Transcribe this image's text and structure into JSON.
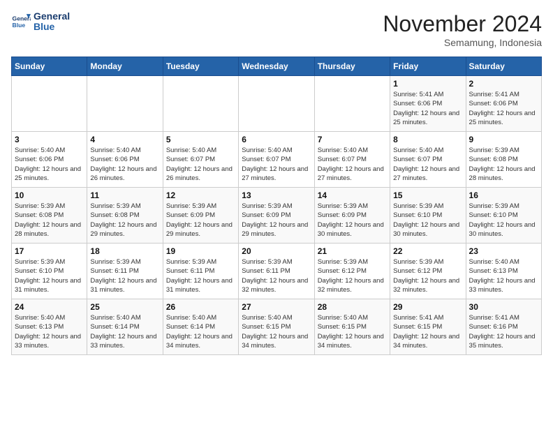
{
  "logo": {
    "text_general": "General",
    "text_blue": "Blue"
  },
  "header": {
    "month": "November 2024",
    "location": "Semamung, Indonesia"
  },
  "weekdays": [
    "Sunday",
    "Monday",
    "Tuesday",
    "Wednesday",
    "Thursday",
    "Friday",
    "Saturday"
  ],
  "weeks": [
    [
      {
        "day": "",
        "info": ""
      },
      {
        "day": "",
        "info": ""
      },
      {
        "day": "",
        "info": ""
      },
      {
        "day": "",
        "info": ""
      },
      {
        "day": "",
        "info": ""
      },
      {
        "day": "1",
        "info": "Sunrise: 5:41 AM\nSunset: 6:06 PM\nDaylight: 12 hours and 25 minutes."
      },
      {
        "day": "2",
        "info": "Sunrise: 5:41 AM\nSunset: 6:06 PM\nDaylight: 12 hours and 25 minutes."
      }
    ],
    [
      {
        "day": "3",
        "info": "Sunrise: 5:40 AM\nSunset: 6:06 PM\nDaylight: 12 hours and 25 minutes."
      },
      {
        "day": "4",
        "info": "Sunrise: 5:40 AM\nSunset: 6:06 PM\nDaylight: 12 hours and 26 minutes."
      },
      {
        "day": "5",
        "info": "Sunrise: 5:40 AM\nSunset: 6:07 PM\nDaylight: 12 hours and 26 minutes."
      },
      {
        "day": "6",
        "info": "Sunrise: 5:40 AM\nSunset: 6:07 PM\nDaylight: 12 hours and 27 minutes."
      },
      {
        "day": "7",
        "info": "Sunrise: 5:40 AM\nSunset: 6:07 PM\nDaylight: 12 hours and 27 minutes."
      },
      {
        "day": "8",
        "info": "Sunrise: 5:40 AM\nSunset: 6:07 PM\nDaylight: 12 hours and 27 minutes."
      },
      {
        "day": "9",
        "info": "Sunrise: 5:39 AM\nSunset: 6:08 PM\nDaylight: 12 hours and 28 minutes."
      }
    ],
    [
      {
        "day": "10",
        "info": "Sunrise: 5:39 AM\nSunset: 6:08 PM\nDaylight: 12 hours and 28 minutes."
      },
      {
        "day": "11",
        "info": "Sunrise: 5:39 AM\nSunset: 6:08 PM\nDaylight: 12 hours and 29 minutes."
      },
      {
        "day": "12",
        "info": "Sunrise: 5:39 AM\nSunset: 6:09 PM\nDaylight: 12 hours and 29 minutes."
      },
      {
        "day": "13",
        "info": "Sunrise: 5:39 AM\nSunset: 6:09 PM\nDaylight: 12 hours and 29 minutes."
      },
      {
        "day": "14",
        "info": "Sunrise: 5:39 AM\nSunset: 6:09 PM\nDaylight: 12 hours and 30 minutes."
      },
      {
        "day": "15",
        "info": "Sunrise: 5:39 AM\nSunset: 6:10 PM\nDaylight: 12 hours and 30 minutes."
      },
      {
        "day": "16",
        "info": "Sunrise: 5:39 AM\nSunset: 6:10 PM\nDaylight: 12 hours and 30 minutes."
      }
    ],
    [
      {
        "day": "17",
        "info": "Sunrise: 5:39 AM\nSunset: 6:10 PM\nDaylight: 12 hours and 31 minutes."
      },
      {
        "day": "18",
        "info": "Sunrise: 5:39 AM\nSunset: 6:11 PM\nDaylight: 12 hours and 31 minutes."
      },
      {
        "day": "19",
        "info": "Sunrise: 5:39 AM\nSunset: 6:11 PM\nDaylight: 12 hours and 31 minutes."
      },
      {
        "day": "20",
        "info": "Sunrise: 5:39 AM\nSunset: 6:11 PM\nDaylight: 12 hours and 32 minutes."
      },
      {
        "day": "21",
        "info": "Sunrise: 5:39 AM\nSunset: 6:12 PM\nDaylight: 12 hours and 32 minutes."
      },
      {
        "day": "22",
        "info": "Sunrise: 5:39 AM\nSunset: 6:12 PM\nDaylight: 12 hours and 32 minutes."
      },
      {
        "day": "23",
        "info": "Sunrise: 5:40 AM\nSunset: 6:13 PM\nDaylight: 12 hours and 33 minutes."
      }
    ],
    [
      {
        "day": "24",
        "info": "Sunrise: 5:40 AM\nSunset: 6:13 PM\nDaylight: 12 hours and 33 minutes."
      },
      {
        "day": "25",
        "info": "Sunrise: 5:40 AM\nSunset: 6:14 PM\nDaylight: 12 hours and 33 minutes."
      },
      {
        "day": "26",
        "info": "Sunrise: 5:40 AM\nSunset: 6:14 PM\nDaylight: 12 hours and 34 minutes."
      },
      {
        "day": "27",
        "info": "Sunrise: 5:40 AM\nSunset: 6:15 PM\nDaylight: 12 hours and 34 minutes."
      },
      {
        "day": "28",
        "info": "Sunrise: 5:40 AM\nSunset: 6:15 PM\nDaylight: 12 hours and 34 minutes."
      },
      {
        "day": "29",
        "info": "Sunrise: 5:41 AM\nSunset: 6:15 PM\nDaylight: 12 hours and 34 minutes."
      },
      {
        "day": "30",
        "info": "Sunrise: 5:41 AM\nSunset: 6:16 PM\nDaylight: 12 hours and 35 minutes."
      }
    ]
  ]
}
